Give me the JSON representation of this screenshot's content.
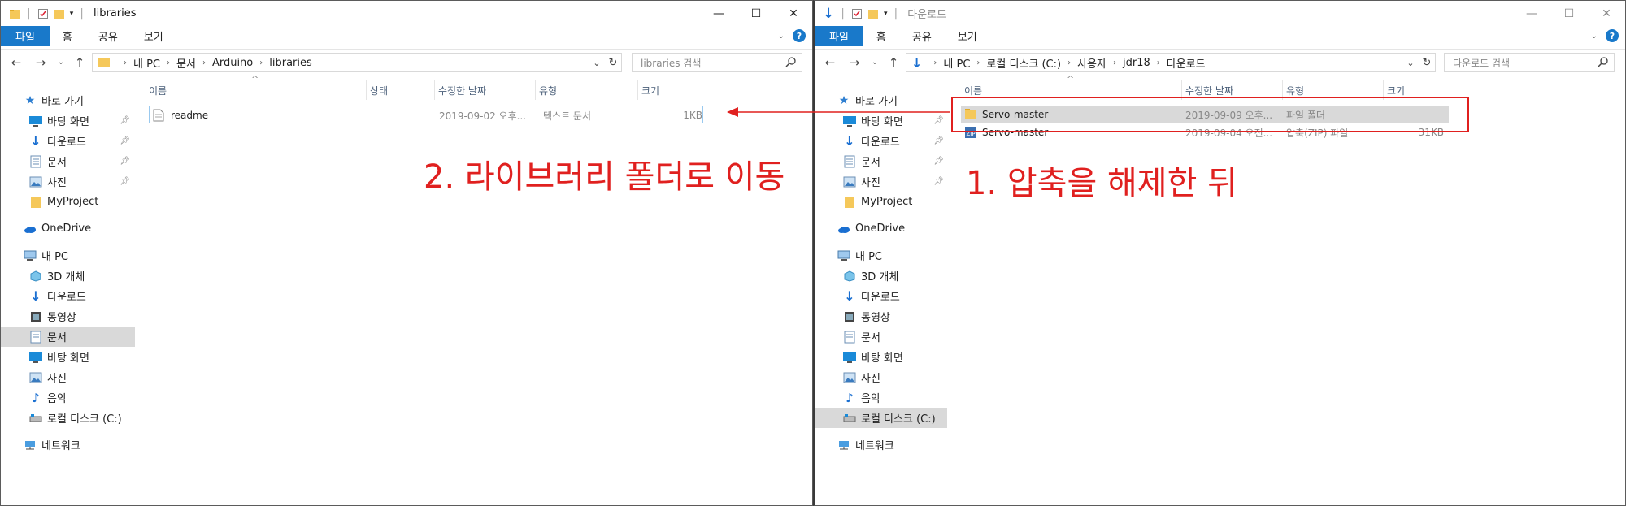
{
  "left": {
    "title": "libraries",
    "ribbon_tabs": [
      "파일",
      "홈",
      "공유",
      "보기"
    ],
    "breadcrumb": [
      "내 PC",
      "문서",
      "Arduino",
      "libraries"
    ],
    "search_placeholder": "libraries 검색",
    "columns": [
      "이름",
      "상태",
      "수정한 날짜",
      "유형",
      "크기"
    ],
    "files": [
      {
        "name": "readme",
        "status": "",
        "date": "2019-09-02 오후...",
        "type": "텍스트 문서",
        "size": "1KB",
        "icon": "text-file-icon"
      }
    ],
    "annotation": "2. 라이브러리 폴더로 이동"
  },
  "right": {
    "title": "다운로드",
    "ribbon_tabs": [
      "파일",
      "홈",
      "공유",
      "보기"
    ],
    "breadcrumb": [
      "내 PC",
      "로컬 디스크 (C:)",
      "사용자",
      "jdr18",
      "다운로드"
    ],
    "search_placeholder": "다운로드 검색",
    "columns": [
      "이름",
      "수정한 날짜",
      "유형",
      "크기"
    ],
    "files": [
      {
        "name": "Servo-master",
        "date": "2019-09-09 오후...",
        "type": "파일 폴더",
        "size": "",
        "icon": "folder-icon"
      },
      {
        "name": "Servo-master",
        "date": "2019-09-04 오전...",
        "type": "압축(ZIP) 파일",
        "size": "31KB",
        "icon": "zip-file-icon"
      }
    ],
    "annotation": "1. 압축을 해제한 뒤"
  },
  "nav": {
    "quick_access": "바로 가기",
    "quick_items": [
      "바탕 화면",
      "다운로드",
      "문서",
      "사진",
      "MyProject"
    ],
    "onedrive": "OneDrive",
    "this_pc": "내 PC",
    "pc_items": [
      "3D 개체",
      "다운로드",
      "동영상",
      "문서",
      "바탕 화면",
      "사진",
      "음악",
      "로컬 디스크 (C:)"
    ],
    "network": "네트워크"
  },
  "colors": {
    "accent": "#1979ca",
    "annotation": "#e0201f",
    "selection": "#d9d9d9"
  }
}
